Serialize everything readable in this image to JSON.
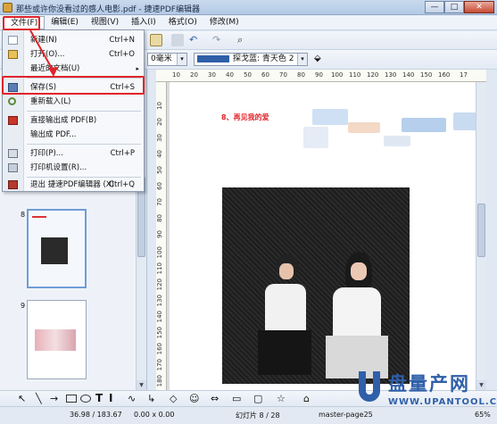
{
  "window": {
    "title": "那些或许你没看过的感人电影.pdf - 捷速PDF编辑器",
    "minimize": "—",
    "maximize": "□",
    "close": "✕"
  },
  "menubar": {
    "items": [
      "文件(F)",
      "编辑(E)",
      "视图(V)",
      "插入(I)",
      "格式(O)",
      "修改(M)"
    ]
  },
  "toolbar2": {
    "size_value": "0毫米",
    "line_style": "探戈蓝: 青天色 2",
    "line_color": "#2f5fa8"
  },
  "file_menu": {
    "items": [
      {
        "label": "新建(N)",
        "shortcut": "Ctrl+N",
        "icon": "new-document-icon"
      },
      {
        "label": "打开(O)...",
        "shortcut": "Ctrl+O",
        "icon": "open-folder-icon"
      },
      {
        "label": "最近的文档(U)",
        "shortcut": "",
        "icon": "",
        "submenu": "▸"
      },
      {
        "label": "保存(S)",
        "shortcut": "Ctrl+S",
        "icon": "save-icon"
      },
      {
        "label": "重新载入(L)",
        "shortcut": "",
        "icon": "reload-icon"
      },
      {
        "label": "直接输出成 PDF(B)",
        "shortcut": "",
        "icon": "pdf-export-icon"
      },
      {
        "label": "输出成 PDF...",
        "shortcut": "",
        "icon": ""
      },
      {
        "label": "打印(P)...",
        "shortcut": "Ctrl+P",
        "icon": "print-icon"
      },
      {
        "label": "打印机设置(R)...",
        "shortcut": "",
        "icon": "printer-settings-icon"
      },
      {
        "label": "退出 捷速PDF编辑器 (X)",
        "shortcut": "Ctrl+Q",
        "icon": "exit-icon"
      }
    ]
  },
  "thumbnails": [
    {
      "number": "8"
    },
    {
      "number": "9"
    }
  ],
  "ruler": {
    "h_ticks": [
      "10",
      "20",
      "30",
      "40",
      "50",
      "60",
      "70",
      "80",
      "90",
      "100",
      "110",
      "120",
      "130",
      "140",
      "150",
      "160",
      "17"
    ],
    "v_ticks": [
      "10",
      "20",
      "30",
      "40",
      "50",
      "60",
      "70",
      "80",
      "90",
      "100",
      "110",
      "120",
      "130",
      "140",
      "150",
      "160",
      "170",
      "180",
      "190"
    ]
  },
  "page": {
    "heading": "8、再见我的爱"
  },
  "statusbar": {
    "coords": "36.98 / 183.67",
    "size": "0.00 x 0.00",
    "slide": "幻灯片 8 / 28",
    "master": "master-page25",
    "zoom": "65%"
  },
  "watermark": {
    "brand": "盘量产网",
    "url": "WWW.UPANTOOL.COM"
  }
}
